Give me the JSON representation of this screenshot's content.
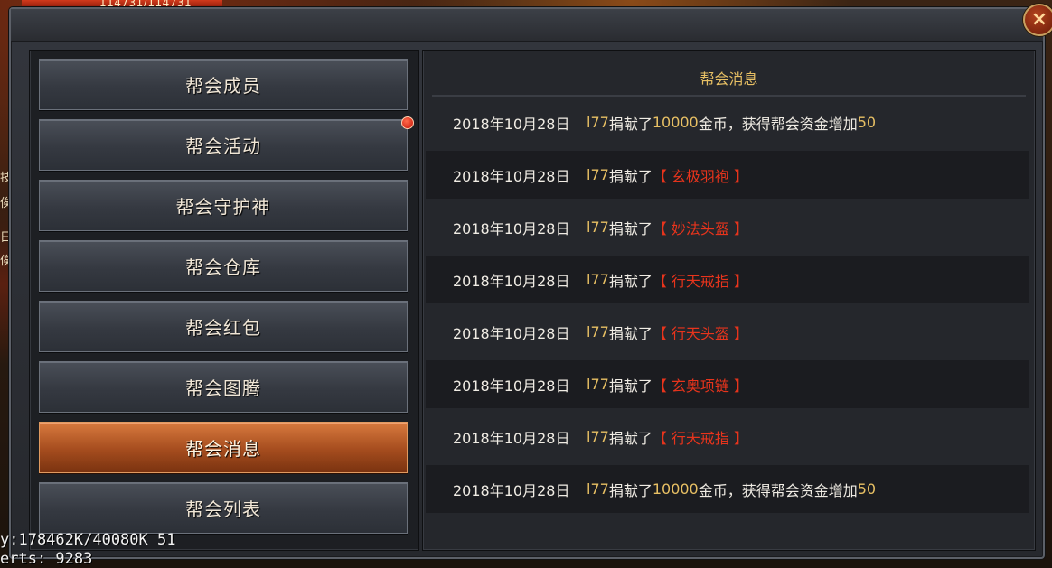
{
  "hud": {
    "hp_text": "114731/114731"
  },
  "side_glyphs": [
    "技",
    "俟",
    "日",
    "俟"
  ],
  "window": {
    "close_icon": "×"
  },
  "menu": {
    "items": [
      {
        "label": "帮会成员",
        "active": false,
        "badge": false
      },
      {
        "label": "帮会活动",
        "active": false,
        "badge": true
      },
      {
        "label": "帮会守护神",
        "active": false,
        "badge": false
      },
      {
        "label": "帮会仓库",
        "active": false,
        "badge": false
      },
      {
        "label": "帮会红包",
        "active": false,
        "badge": false
      },
      {
        "label": "帮会图腾",
        "active": false,
        "badge": false
      },
      {
        "label": "帮会消息",
        "active": true,
        "badge": false
      },
      {
        "label": "帮会列表",
        "active": false,
        "badge": false
      }
    ]
  },
  "messages": {
    "title": "帮会消息",
    "rows": [
      {
        "date": "2018年10月28日",
        "name": "l77",
        "verb": "捐献了",
        "amount": "10000",
        "suffix_a": "金币，获得帮会资金增加",
        "bonus": "50",
        "item": ""
      },
      {
        "date": "2018年10月28日",
        "name": "l77",
        "verb": "捐献了",
        "amount": "",
        "suffix_a": "",
        "bonus": "",
        "item": "【 玄极羽袍 】"
      },
      {
        "date": "2018年10月28日",
        "name": "l77",
        "verb": "捐献了",
        "amount": "",
        "suffix_a": "",
        "bonus": "",
        "item": "【 妙法头盔 】"
      },
      {
        "date": "2018年10月28日",
        "name": "l77",
        "verb": "捐献了",
        "amount": "",
        "suffix_a": "",
        "bonus": "",
        "item": "【 行天戒指 】"
      },
      {
        "date": "2018年10月28日",
        "name": "l77",
        "verb": "捐献了",
        "amount": "",
        "suffix_a": "",
        "bonus": "",
        "item": "【 行天头盔 】"
      },
      {
        "date": "2018年10月28日",
        "name": "l77",
        "verb": "捐献了",
        "amount": "",
        "suffix_a": "",
        "bonus": "",
        "item": "【 玄奥项链 】"
      },
      {
        "date": "2018年10月28日",
        "name": "l77",
        "verb": "捐献了",
        "amount": "",
        "suffix_a": "",
        "bonus": "",
        "item": "【 行天戒指 】"
      },
      {
        "date": "2018年10月28日",
        "name": "l77",
        "verb": "捐献了",
        "amount": "10000",
        "suffix_a": "金币，获得帮会资金增加",
        "bonus": "50",
        "item": ""
      }
    ]
  },
  "debug": {
    "line1": "y:178462K/40080K 51",
    "line2": "erts:  9283"
  },
  "colors": {
    "gold": "#e8c064",
    "item_red": "#e8341c",
    "active_orange": "#c0602a"
  }
}
